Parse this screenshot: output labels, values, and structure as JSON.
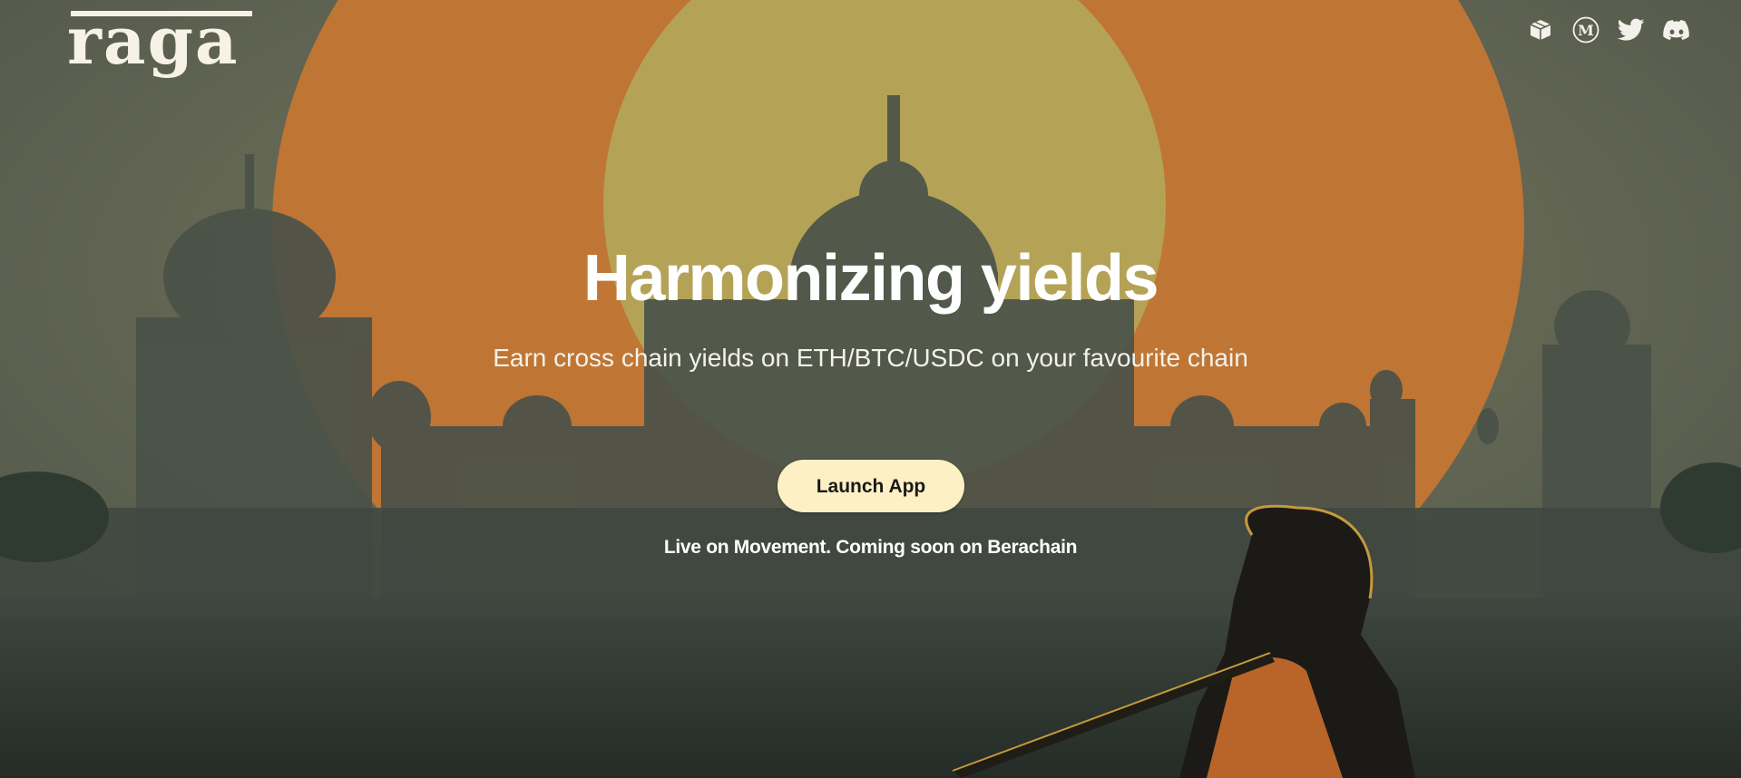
{
  "brand": {
    "logo_text": "raga"
  },
  "social": {
    "items": [
      {
        "name": "docs",
        "icon": "box-icon",
        "label": "Docs"
      },
      {
        "name": "medium",
        "icon": "medium-icon",
        "label": "Medium"
      },
      {
        "name": "twitter",
        "icon": "twitter-icon",
        "label": "Twitter"
      },
      {
        "name": "discord",
        "icon": "discord-icon",
        "label": "Discord"
      }
    ]
  },
  "hero": {
    "headline": "Harmonizing yields",
    "subheadline": "Earn cross chain yields on ETH/BTC/USDC on your favourite chain",
    "cta_label": "Launch App",
    "status_text": "Live on Movement. Coming soon on Berachain"
  },
  "colors": {
    "cta_background": "#fdf0c4",
    "sun_outer": "#c87a35",
    "sun_inner": "#b9a25a",
    "silhouette": "#3a4238",
    "text": "#ffffff"
  }
}
